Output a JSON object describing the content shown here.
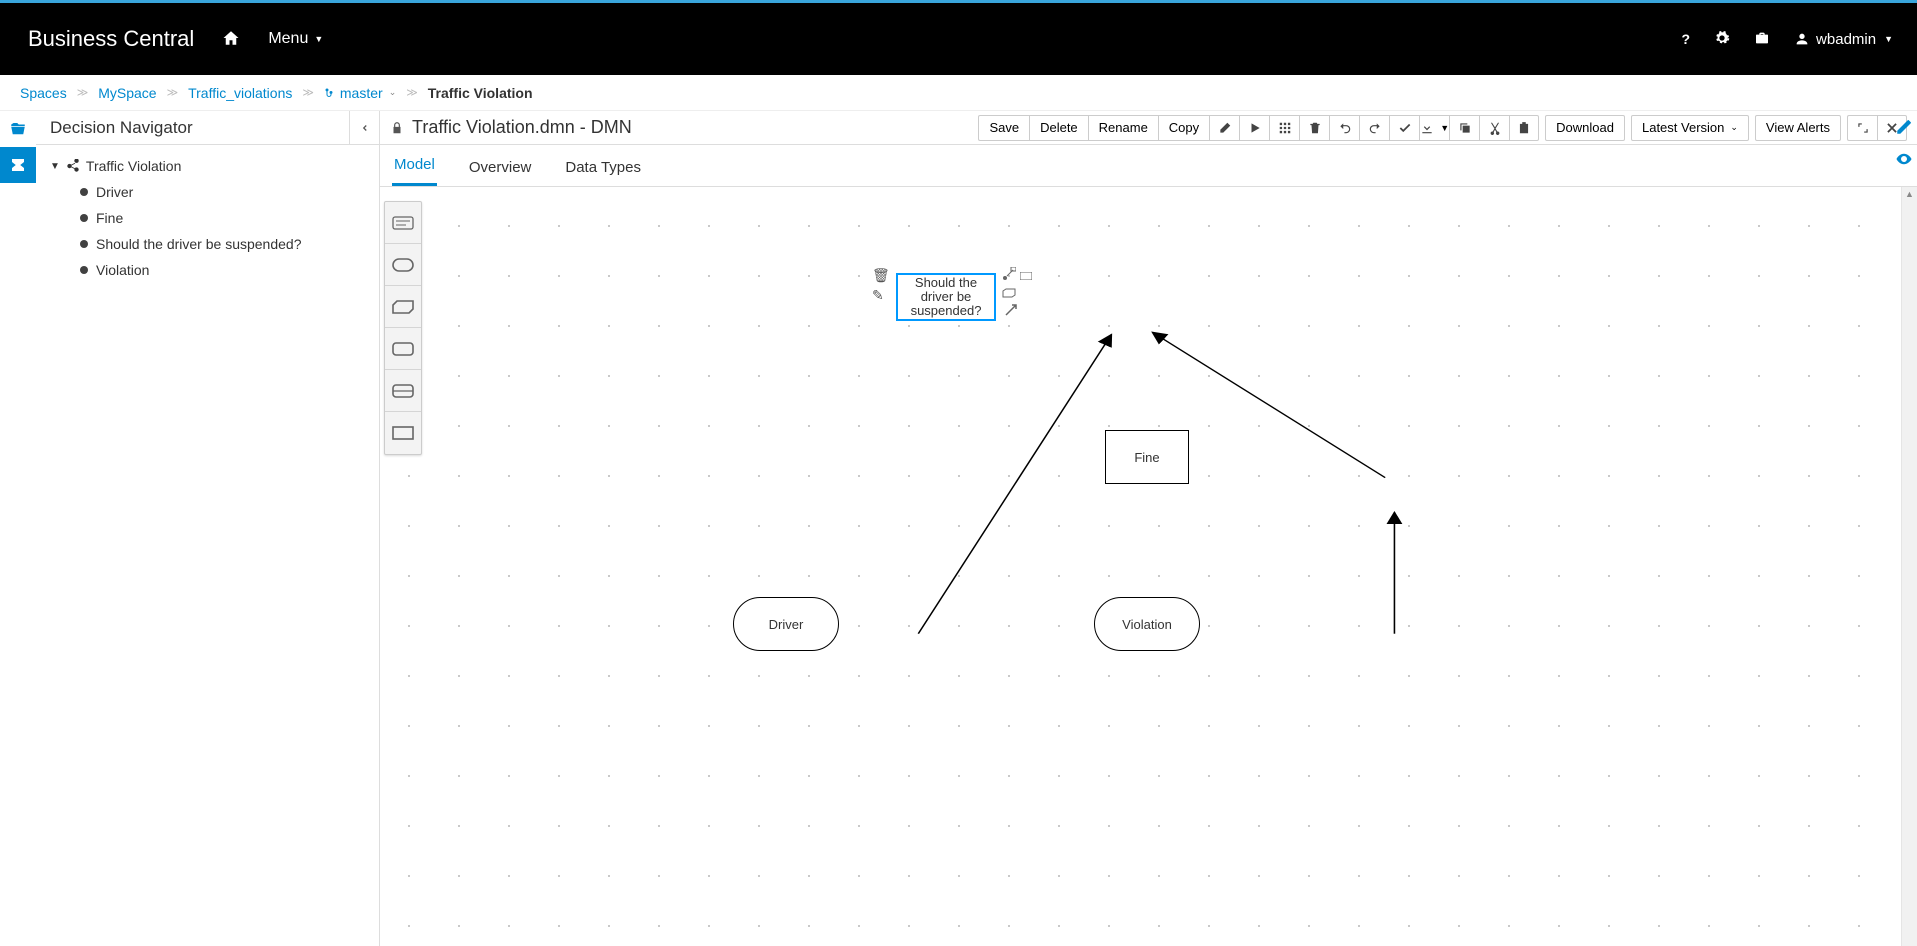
{
  "header": {
    "brand": "Business Central",
    "menu_label": "Menu",
    "user": "wbadmin"
  },
  "breadcrumb": {
    "spaces": "Spaces",
    "space": "MySpace",
    "project": "Traffic_violations",
    "branch": "master",
    "current": "Traffic Violation"
  },
  "sidebar": {
    "title": "Decision Navigator",
    "root": "Traffic Violation",
    "items": [
      "Driver",
      "Fine",
      "Should the driver be suspended?",
      "Violation"
    ]
  },
  "editor": {
    "title": "Traffic Violation.dmn - DMN",
    "buttons": {
      "save": "Save",
      "delete": "Delete",
      "rename": "Rename",
      "copy": "Copy",
      "download": "Download",
      "latest_version": "Latest Version",
      "view_alerts": "View Alerts"
    },
    "tabs": {
      "model": "Model",
      "overview": "Overview",
      "datatypes": "Data Types"
    }
  },
  "diagram": {
    "should_suspend": "Should the driver be suspended?",
    "fine": "Fine",
    "driver": "Driver",
    "violation": "Violation"
  }
}
